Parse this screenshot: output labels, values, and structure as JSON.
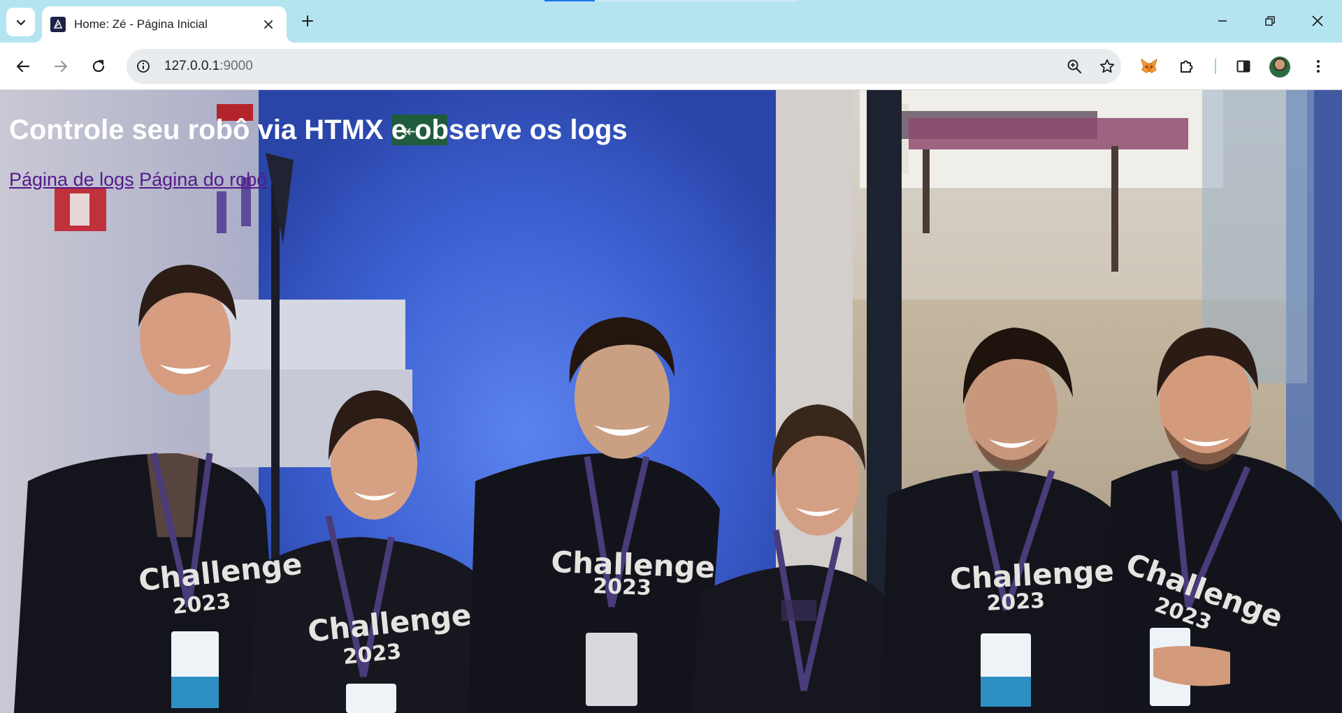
{
  "browser": {
    "tab": {
      "title": "Home: Zé - Página Inicial"
    },
    "omnibox": {
      "url_host": "127.0.0.1",
      "url_port": ":9000"
    }
  },
  "page": {
    "title": "Controle seu robô via HTMX e observe os logs",
    "links": [
      {
        "label": "Página de logs"
      },
      {
        "label": "Página do robô"
      }
    ],
    "hero_image": {
      "shirt_text": "Challenge",
      "shirt_year": "2023",
      "exit_sign": "↞"
    }
  },
  "colors": {
    "tabstrip": "#b5e4f1",
    "link_visited": "#551a8b",
    "title_text": "#ffffff",
    "wall_blue": "#3f63d6"
  }
}
